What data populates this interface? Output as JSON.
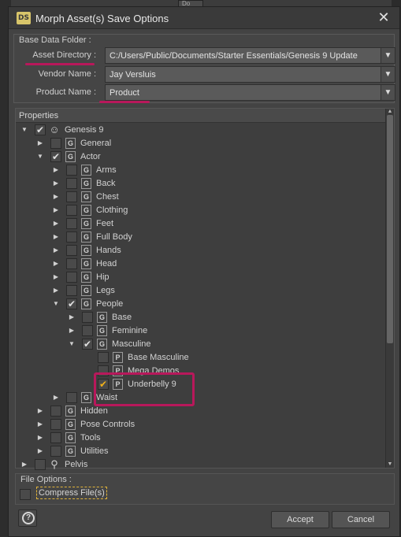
{
  "dialog": {
    "app_icon": "DS",
    "title": "Morph Asset(s) Save Options",
    "close_glyph": "✕"
  },
  "background": {
    "tab_hint": "Do"
  },
  "base_data_folder": {
    "group_title": "Base Data Folder :",
    "asset_directory": {
      "label": "Asset Directory :",
      "value": "C:/Users/Public/Documents/Starter Essentials/Genesis 9 Update"
    },
    "vendor_name": {
      "label": "Vendor Name :",
      "value": "Jay Versluis"
    },
    "product_name": {
      "label": "Product Name :",
      "value": "Product"
    },
    "dropdown_glyph": "▼"
  },
  "properties": {
    "header": "Properties",
    "rows": [
      {
        "label": "Genesis 9",
        "icon": "figure-icon",
        "checked": true,
        "expanded": true
      },
      {
        "label": "General",
        "icon": "group-icon",
        "checked": false,
        "expanded": false
      },
      {
        "label": "Actor",
        "icon": "group-icon",
        "checked": true,
        "expanded": true
      },
      {
        "label": "Arms",
        "icon": "group-icon",
        "checked": false
      },
      {
        "label": "Back",
        "icon": "group-icon",
        "checked": false
      },
      {
        "label": "Chest",
        "icon": "group-icon",
        "checked": false
      },
      {
        "label": "Clothing",
        "icon": "group-icon",
        "checked": false
      },
      {
        "label": "Feet",
        "icon": "group-icon",
        "checked": false
      },
      {
        "label": "Full Body",
        "icon": "group-icon",
        "checked": false
      },
      {
        "label": "Hands",
        "icon": "group-icon",
        "checked": false
      },
      {
        "label": "Head",
        "icon": "group-icon",
        "checked": false
      },
      {
        "label": "Hip",
        "icon": "group-icon",
        "checked": false
      },
      {
        "label": "Legs",
        "icon": "group-icon",
        "checked": false
      },
      {
        "label": "People",
        "icon": "group-icon",
        "checked": true,
        "expanded": true
      },
      {
        "label": "Base",
        "icon": "group-icon",
        "checked": false
      },
      {
        "label": "Feminine",
        "icon": "group-icon",
        "checked": false
      },
      {
        "label": "Masculine",
        "icon": "group-icon",
        "checked": true,
        "expanded": true
      },
      {
        "label": "Base Masculine",
        "icon": "property-icon",
        "checked": false
      },
      {
        "label": "Mega Demos",
        "icon": "property-icon",
        "checked": false
      },
      {
        "label": "Underbelly 9",
        "icon": "property-icon",
        "checked": true,
        "highlighted": true
      },
      {
        "label": "Waist",
        "icon": "group-icon",
        "checked": false
      },
      {
        "label": "Hidden",
        "icon": "group-icon",
        "checked": false
      },
      {
        "label": "Pose Controls",
        "icon": "group-icon",
        "checked": false
      },
      {
        "label": "Tools",
        "icon": "group-icon",
        "checked": false
      },
      {
        "label": "Utilities",
        "icon": "group-icon",
        "checked": false
      },
      {
        "label": "Pelvis",
        "icon": "bone-icon",
        "checked": false
      }
    ],
    "group_glyph": "G",
    "property_glyph": "P",
    "check_glyph": "✔",
    "arrow_collapsed": "▶",
    "arrow_expanded": "▼",
    "scroll_up": "▲",
    "scroll_down": "▼"
  },
  "file_options": {
    "group_title": "File Options :",
    "compress_label": "Compress File(s)",
    "compress_checked": false
  },
  "buttons": {
    "help": "?",
    "accept": "Accept",
    "cancel": "Cancel"
  },
  "colors": {
    "annotation": "#b8185b",
    "check_orange": "#f2b21a"
  }
}
